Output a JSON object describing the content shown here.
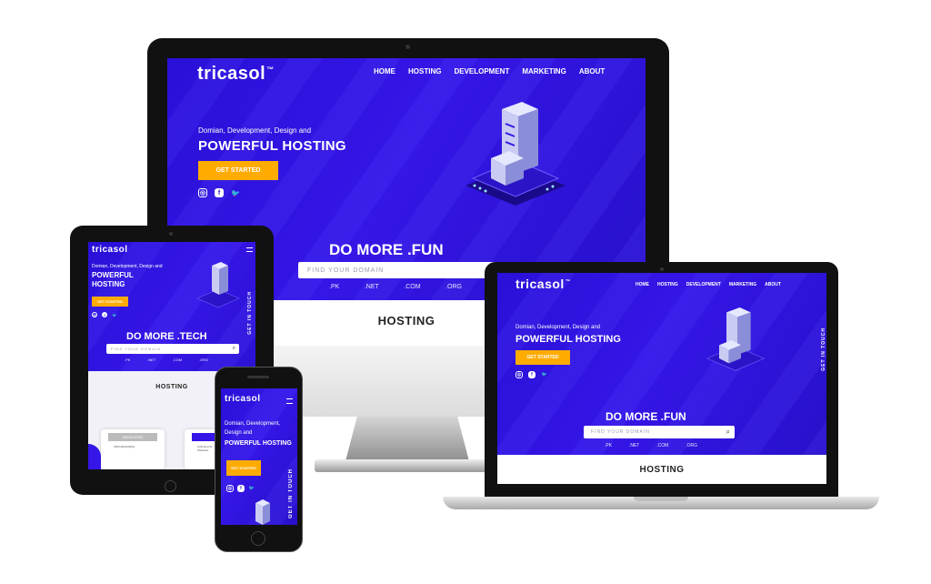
{
  "brand": {
    "logo": "tricasol",
    "tm": "™"
  },
  "nav": {
    "home": "HOME",
    "hosting": "HOSTING",
    "development": "DEVELOPMENT",
    "marketing": "MARKETING",
    "about": "ABOUT"
  },
  "hero": {
    "subtitle": "Domian, Development, Design and",
    "title": "POWERFUL HOSTING",
    "tablet_title_1": "POWERFUL",
    "tablet_title_2": "HOSTING",
    "cta": "GET STARTED"
  },
  "social": {
    "instagram": "◎",
    "facebook": "f",
    "twitter": "🐦"
  },
  "domain": {
    "heading_fun": "DO MORE .FUN",
    "heading_tech": "DO MORE .TECH",
    "placeholder": "FIND YOUR DOMAIN",
    "placeholder_small": "FIND YOUR DOMAIN",
    "tlds": [
      ".PK",
      ".NET",
      ".COM",
      ".ORG"
    ]
  },
  "section": {
    "hosting": "HOSTING"
  },
  "side": {
    "get_in_touch": "GET IN TOUCH"
  },
  "plans": {
    "dedicated": "DEDICATED",
    "shared": "SHARI",
    "processor": "PROCESSOR(S)",
    "unlimited": "Unlimited W",
    "webs": "Websites"
  },
  "colors": {
    "hero_blue": "#2f14e0",
    "accent": "#ffab00",
    "bezel": "#111111"
  }
}
